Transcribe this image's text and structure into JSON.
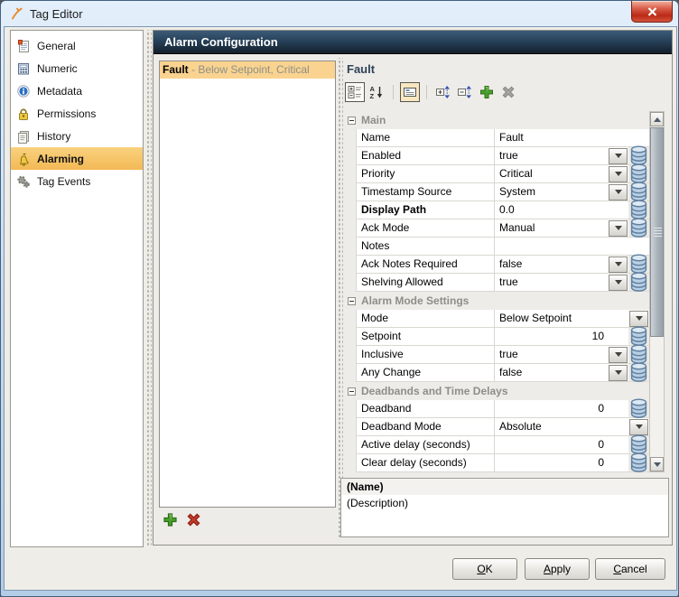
{
  "window": {
    "title": "Tag Editor"
  },
  "sidebar": {
    "items": [
      {
        "label": "General",
        "icon": "general-icon",
        "selected": false
      },
      {
        "label": "Numeric",
        "icon": "numeric-icon",
        "selected": false
      },
      {
        "label": "Metadata",
        "icon": "metadata-icon",
        "selected": false
      },
      {
        "label": "Permissions",
        "icon": "permissions-icon",
        "selected": false
      },
      {
        "label": "History",
        "icon": "history-icon",
        "selected": false
      },
      {
        "label": "Alarming",
        "icon": "alarming-icon",
        "selected": true
      },
      {
        "label": "Tag Events",
        "icon": "tag-events-icon",
        "selected": false
      }
    ]
  },
  "main": {
    "header": "Alarm Configuration",
    "alarm_list": {
      "items": [
        {
          "name": "Fault",
          "detail": " - Below Setpoint, Critical",
          "selected": true
        }
      ]
    },
    "properties": {
      "title": "Fault",
      "toolbar": [
        "categorize-icon",
        "sort-az-icon",
        "description-toggle-icon",
        "expand-all-icon",
        "collapse-all-icon",
        "add-property-icon",
        "remove-property-icon"
      ],
      "sections": [
        {
          "label": "Main",
          "rows": [
            {
              "name": "Name",
              "value": "Fault",
              "dropdown": false,
              "binding": false
            },
            {
              "name": "Enabled",
              "value": "true",
              "dropdown": true,
              "binding": true
            },
            {
              "name": "Priority",
              "value": "Critical",
              "dropdown": true,
              "binding": true
            },
            {
              "name": "Timestamp Source",
              "value": "System",
              "dropdown": true,
              "binding": true
            },
            {
              "name": "Display Path",
              "value": "0.0",
              "bold": true,
              "dropdown": false,
              "binding": true
            },
            {
              "name": "Ack Mode",
              "value": "Manual",
              "dropdown": true,
              "binding": true
            },
            {
              "name": "Notes",
              "value": "",
              "dropdown": false,
              "binding": false
            },
            {
              "name": "Ack Notes Required",
              "value": "false",
              "dropdown": true,
              "binding": true
            },
            {
              "name": "Shelving Allowed",
              "value": "true",
              "dropdown": true,
              "binding": true
            }
          ]
        },
        {
          "label": "Alarm Mode Settings",
          "rows": [
            {
              "name": "Mode",
              "value": "Below Setpoint",
              "dropdown": true,
              "binding": false
            },
            {
              "name": "Setpoint",
              "value": "10",
              "align": "right",
              "dropdown": false,
              "binding": true
            },
            {
              "name": "Inclusive",
              "value": "true",
              "dropdown": true,
              "binding": true
            },
            {
              "name": "Any Change",
              "value": "false",
              "dropdown": true,
              "binding": true
            }
          ]
        },
        {
          "label": "Deadbands and Time Delays",
          "rows": [
            {
              "name": "Deadband",
              "value": "0",
              "align": "right",
              "dropdown": false,
              "binding": true
            },
            {
              "name": "Deadband Mode",
              "value": "Absolute",
              "dropdown": true,
              "binding": false
            },
            {
              "name": "Active delay (seconds)",
              "value": "0",
              "align": "right",
              "dropdown": false,
              "binding": true
            },
            {
              "name": "Clear delay (seconds)",
              "value": "0",
              "align": "right",
              "dropdown": false,
              "binding": true
            }
          ]
        }
      ],
      "description_panel": {
        "name": "(Name)",
        "description": "(Description)"
      }
    }
  },
  "buttons": {
    "ok": "OK",
    "apply": "Apply",
    "cancel": "Cancel"
  },
  "colors": {
    "header_navy": "#27415a",
    "selection_orange": "#f3b955",
    "list_selection_tan": "#f9d38f",
    "title_navy": "#2f4358",
    "close_red": "#bb2a16",
    "add_green": "#4aa02c",
    "remove_red": "#c53a2b"
  }
}
